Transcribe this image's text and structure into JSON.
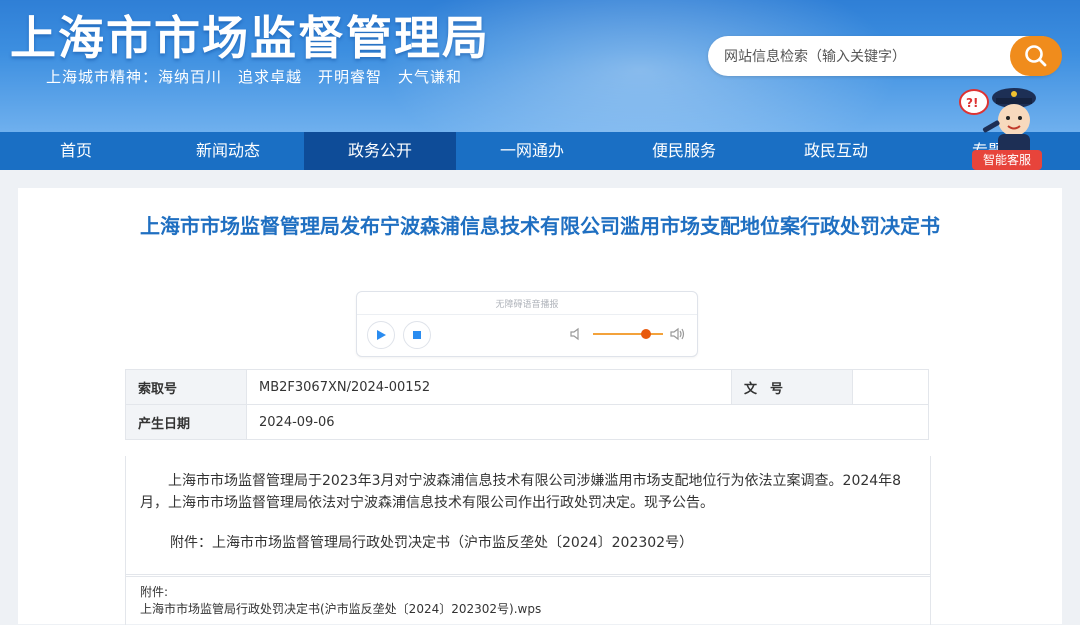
{
  "header": {
    "site_title": "上海市市场监督管理局",
    "slogan": "上海城市精神：海纳百川　追求卓越　开明睿智　大气谦和",
    "search_placeholder": "网站信息检索（输入关键字）",
    "accent_color": "#f08c1c",
    "assistant_label": "智能客服"
  },
  "nav": {
    "items": [
      {
        "label": "首页"
      },
      {
        "label": "新闻动态"
      },
      {
        "label": "政务公开",
        "active": true
      },
      {
        "label": "一网通办"
      },
      {
        "label": "便民服务"
      },
      {
        "label": "政民互动"
      },
      {
        "label": "专题"
      }
    ]
  },
  "article": {
    "title": "上海市市场监督管理局发布宁波森浦信息技术有限公司滥用市场支配地位案行政处罚决定书",
    "player_caption": "无障碍语音播报",
    "meta": {
      "index_label": "索取号",
      "index_value": "MB2F3067XN/2024-00152",
      "doc_label": "文　号",
      "doc_value": "",
      "date_label": "产生日期",
      "date_value": "2024-09-06"
    },
    "paragraph": "上海市市场监督管理局于2023年3月对宁波森浦信息技术有限公司涉嫌滥用市场支配地位行为依法立案调查。2024年8月，上海市市场监督管理局依法对宁波森浦信息技术有限公司作出行政处罚决定。现予公告。",
    "attachment_line": "附件：上海市市场监督管理局行政处罚决定书（沪市监反垄处〔2024〕202302号）",
    "attachments_label": "附件:",
    "attachment_file": "上海市市场监管局行政处罚决定书(沪市监反垄处〔2024〕202302号).wps"
  }
}
